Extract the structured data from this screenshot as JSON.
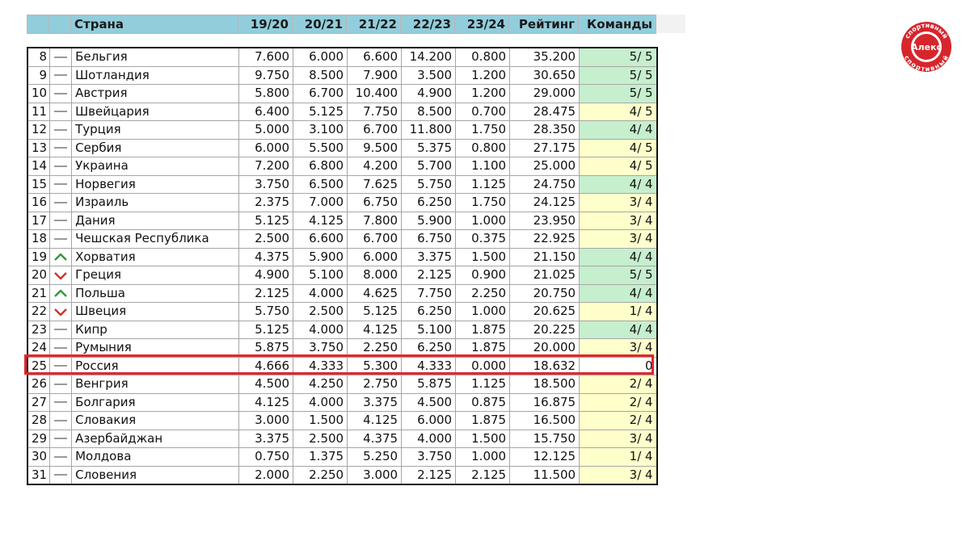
{
  "header": {
    "country": "Страна",
    "seasons": [
      "19/20",
      "20/21",
      "21/22",
      "22/23",
      "23/24"
    ],
    "rating": "Рейтинг",
    "teams": "Команды"
  },
  "rows": [
    {
      "rank": "8",
      "trend": "same",
      "country": "Бельгия",
      "s1": "7.600",
      "s2": "6.000",
      "s3": "6.600",
      "s4": "14.200",
      "s5": "0.800",
      "rating": "35.200",
      "teams": "5/ 5",
      "teams_status": "green"
    },
    {
      "rank": "9",
      "trend": "same",
      "country": "Шотландия",
      "s1": "9.750",
      "s2": "8.500",
      "s3": "7.900",
      "s4": "3.500",
      "s5": "1.200",
      "rating": "30.650",
      "teams": "5/ 5",
      "teams_status": "green"
    },
    {
      "rank": "10",
      "trend": "same",
      "country": "Австрия",
      "s1": "5.800",
      "s2": "6.700",
      "s3": "10.400",
      "s4": "4.900",
      "s5": "1.200",
      "rating": "29.000",
      "teams": "5/ 5",
      "teams_status": "green"
    },
    {
      "rank": "11",
      "trend": "same",
      "country": "Швейцария",
      "s1": "6.400",
      "s2": "5.125",
      "s3": "7.750",
      "s4": "8.500",
      "s5": "0.700",
      "rating": "28.475",
      "teams": "4/ 5",
      "teams_status": "yellow"
    },
    {
      "rank": "12",
      "trend": "same",
      "country": "Турция",
      "s1": "5.000",
      "s2": "3.100",
      "s3": "6.700",
      "s4": "11.800",
      "s5": "1.750",
      "rating": "28.350",
      "teams": "4/ 4",
      "teams_status": "green"
    },
    {
      "rank": "13",
      "trend": "same",
      "country": "Сербия",
      "s1": "6.000",
      "s2": "5.500",
      "s3": "9.500",
      "s4": "5.375",
      "s5": "0.800",
      "rating": "27.175",
      "teams": "4/ 5",
      "teams_status": "yellow"
    },
    {
      "rank": "14",
      "trend": "same",
      "country": "Украина",
      "s1": "7.200",
      "s2": "6.800",
      "s3": "4.200",
      "s4": "5.700",
      "s5": "1.100",
      "rating": "25.000",
      "teams": "4/ 5",
      "teams_status": "yellow"
    },
    {
      "rank": "15",
      "trend": "same",
      "country": "Норвегия",
      "s1": "3.750",
      "s2": "6.500",
      "s3": "7.625",
      "s4": "5.750",
      "s5": "1.125",
      "rating": "24.750",
      "teams": "4/ 4",
      "teams_status": "green"
    },
    {
      "rank": "16",
      "trend": "same",
      "country": "Израиль",
      "s1": "2.375",
      "s2": "7.000",
      "s3": "6.750",
      "s4": "6.250",
      "s5": "1.750",
      "rating": "24.125",
      "teams": "3/ 4",
      "teams_status": "yellow"
    },
    {
      "rank": "17",
      "trend": "same",
      "country": "Дания",
      "s1": "5.125",
      "s2": "4.125",
      "s3": "7.800",
      "s4": "5.900",
      "s5": "1.000",
      "rating": "23.950",
      "teams": "3/ 4",
      "teams_status": "yellow"
    },
    {
      "rank": "18",
      "trend": "same",
      "country": "Чешская Республика",
      "s1": "2.500",
      "s2": "6.600",
      "s3": "6.700",
      "s4": "6.750",
      "s5": "0.375",
      "rating": "22.925",
      "teams": "3/ 4",
      "teams_status": "yellow"
    },
    {
      "rank": "19",
      "trend": "up",
      "country": "Хорватия",
      "s1": "4.375",
      "s2": "5.900",
      "s3": "6.000",
      "s4": "3.375",
      "s5": "1.500",
      "rating": "21.150",
      "teams": "4/ 4",
      "teams_status": "green"
    },
    {
      "rank": "20",
      "trend": "down",
      "country": "Греция",
      "s1": "4.900",
      "s2": "5.100",
      "s3": "8.000",
      "s4": "2.125",
      "s5": "0.900",
      "rating": "21.025",
      "teams": "5/ 5",
      "teams_status": "green"
    },
    {
      "rank": "21",
      "trend": "up",
      "country": "Польша",
      "s1": "2.125",
      "s2": "4.000",
      "s3": "4.625",
      "s4": "7.750",
      "s5": "2.250",
      "rating": "20.750",
      "teams": "4/ 4",
      "teams_status": "green"
    },
    {
      "rank": "22",
      "trend": "down",
      "country": "Швеция",
      "s1": "5.750",
      "s2": "2.500",
      "s3": "5.125",
      "s4": "6.250",
      "s5": "1.000",
      "rating": "20.625",
      "teams": "1/ 4",
      "teams_status": "yellow"
    },
    {
      "rank": "23",
      "trend": "same",
      "country": "Кипр",
      "s1": "5.125",
      "s2": "4.000",
      "s3": "4.125",
      "s4": "5.100",
      "s5": "1.875",
      "rating": "20.225",
      "teams": "4/ 4",
      "teams_status": "green"
    },
    {
      "rank": "24",
      "trend": "same",
      "country": "Румыния",
      "s1": "5.875",
      "s2": "3.750",
      "s3": "2.250",
      "s4": "6.250",
      "s5": "1.875",
      "rating": "20.000",
      "teams": "3/ 4",
      "teams_status": "yellow"
    },
    {
      "rank": "25",
      "trend": "same",
      "country": "Россия",
      "s1": "4.666",
      "s2": "4.333",
      "s3": "5.300",
      "s4": "4.333",
      "s5": "0.000",
      "rating": "18.632",
      "teams": "0",
      "teams_status": "none"
    },
    {
      "rank": "26",
      "trend": "same",
      "country": "Венгрия",
      "s1": "4.500",
      "s2": "4.250",
      "s3": "2.750",
      "s4": "5.875",
      "s5": "1.125",
      "rating": "18.500",
      "teams": "2/ 4",
      "teams_status": "yellow"
    },
    {
      "rank": "27",
      "trend": "same",
      "country": "Болгария",
      "s1": "4.125",
      "s2": "4.000",
      "s3": "3.375",
      "s4": "4.500",
      "s5": "0.875",
      "rating": "16.875",
      "teams": "2/ 4",
      "teams_status": "yellow"
    },
    {
      "rank": "28",
      "trend": "same",
      "country": "Словакия",
      "s1": "3.000",
      "s2": "1.500",
      "s3": "4.125",
      "s4": "6.000",
      "s5": "1.875",
      "rating": "16.500",
      "teams": "2/ 4",
      "teams_status": "yellow"
    },
    {
      "rank": "29",
      "trend": "same",
      "country": "Азербайджан",
      "s1": "3.375",
      "s2": "2.500",
      "s3": "4.375",
      "s4": "4.000",
      "s5": "1.500",
      "rating": "15.750",
      "teams": "3/ 4",
      "teams_status": "yellow"
    },
    {
      "rank": "30",
      "trend": "same",
      "country": "Молдова",
      "s1": "0.750",
      "s2": "1.375",
      "s3": "5.250",
      "s4": "3.750",
      "s5": "1.000",
      "rating": "12.125",
      "teams": "1/ 4",
      "teams_status": "yellow"
    },
    {
      "rank": "31",
      "trend": "same",
      "country": "Словения",
      "s1": "2.000",
      "s2": "2.250",
      "s3": "3.000",
      "s4": "2.125",
      "s5": "2.125",
      "rating": "11.500",
      "teams": "3/ 4",
      "teams_status": "yellow"
    }
  ],
  "highlight_rank": "25",
  "logo": {
    "text_main": "Алекс",
    "text_ring": "спортивный"
  },
  "colors": {
    "header_bg": "#92cddc",
    "teams_green": "#c6efce",
    "teams_yellow": "#ffffcc",
    "highlight_border": "#e3262d",
    "trend_up": "#2e9a3a",
    "trend_down": "#d6302b",
    "trend_same": "#9a9a9a"
  }
}
